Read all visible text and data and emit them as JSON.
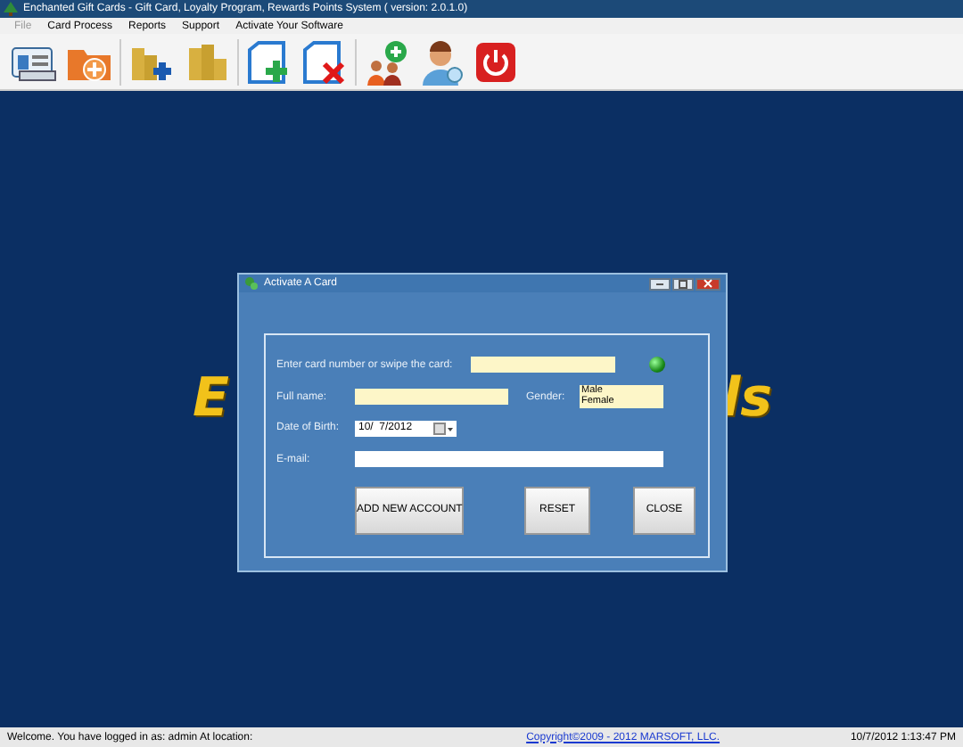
{
  "window": {
    "title": "Enchanted Gift Cards - Gift Card, Loyalty Program, Rewards Points System ( version: 2.0.1.0)"
  },
  "menu": [
    {
      "label": "File",
      "disabled": true
    },
    {
      "label": "Card Process",
      "disabled": false
    },
    {
      "label": "Reports",
      "disabled": false
    },
    {
      "label": "Support",
      "disabled": false
    },
    {
      "label": "Activate Your Software",
      "disabled": false
    }
  ],
  "background_logo": {
    "left": "E",
    "right": "ls"
  },
  "dialog": {
    "title": "Activate A Card",
    "card_label": "Enter card number or swipe the card:",
    "full_name_label": "Full name:",
    "gender_label": "Gender:",
    "gender_options": [
      {
        "label": "Male",
        "selected": false
      },
      {
        "label": "Female",
        "selected": false
      }
    ],
    "dob_label": "Date of Birth:",
    "dob_value": "10/  7/2012",
    "email_label": "E-mail:",
    "buttons": [
      "ADD NEW ACCOUNT",
      "RESET",
      "CLOSE"
    ]
  },
  "status_bar": {
    "welcome": "Welcome. You have logged in as: admin At location:",
    "copyright": "Copyright©2009 - 2012 MARSOFT, LLC.",
    "datetime": "10/7/2012 1:13:47 PM"
  }
}
